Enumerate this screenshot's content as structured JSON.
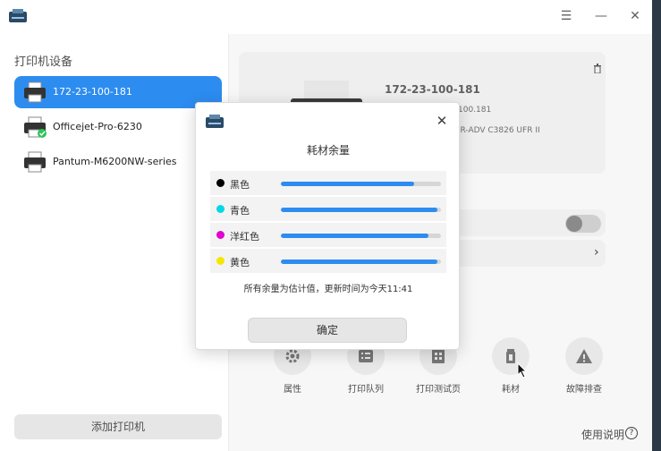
{
  "window": {
    "menu_icon": "☰",
    "minimize_icon": "—",
    "close_icon": "✕"
  },
  "sidebar": {
    "title": "打印机设备",
    "printers": [
      {
        "label": "172-23-100-181",
        "selected": true
      },
      {
        "label": "Officejet-Pro-6230",
        "status": "ok"
      },
      {
        "label": "Pantum-M6200NW-series"
      }
    ],
    "add_label": "添加打印机"
  },
  "detail": {
    "name": "172-23-100-181",
    "ip_partial": "100.181",
    "model_partial": "iR-ADV C3826 UFR II"
  },
  "actions": [
    {
      "label": "属性",
      "icon": "gear-icon"
    },
    {
      "label": "打印队列",
      "icon": "queue-icon"
    },
    {
      "label": "打印测试页",
      "icon": "test-page-icon"
    },
    {
      "label": "耗材",
      "icon": "supplies-icon"
    },
    {
      "label": "故障排查",
      "icon": "warning-icon"
    }
  ],
  "help": {
    "label": "使用说明",
    "icon_glyph": "?"
  },
  "dialog": {
    "title": "耗材余量",
    "close_icon": "✕",
    "supplies": [
      {
        "name": "黑色",
        "color": "#000000",
        "level": 0.83
      },
      {
        "name": "青色",
        "color": "#00d8e8",
        "level": 0.98
      },
      {
        "name": "洋红色",
        "color": "#e000d0",
        "level": 0.92
      },
      {
        "name": "黄色",
        "color": "#f5e800",
        "level": 0.98
      }
    ],
    "note": "所有余量为估计值，更新时间为今天11:41",
    "ok_label": "确定"
  },
  "colors": {
    "accent": "#2d8cf0"
  }
}
